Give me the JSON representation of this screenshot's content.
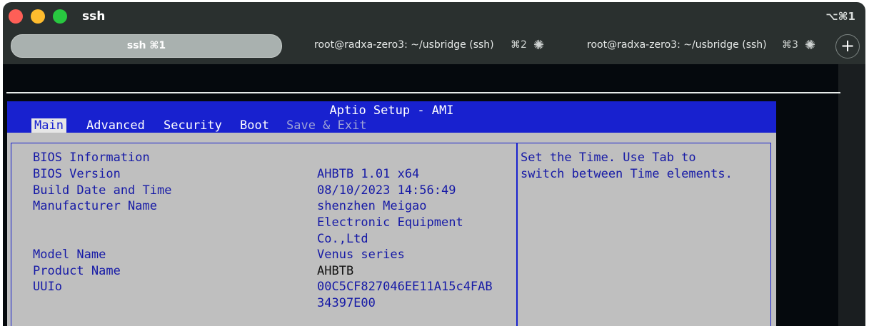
{
  "window": {
    "title": "ssh",
    "shortcut": "⌥⌘1"
  },
  "tabs": [
    {
      "label": "ssh ⌘1"
    },
    {
      "label": "root@radxa-zero3: ~/usbridge (ssh)",
      "key": "⌘2"
    },
    {
      "label": "root@radxa-zero3: ~/usbridge (ssh)",
      "key": "⌘3"
    }
  ],
  "new_tab_label": "+",
  "bios": {
    "title": "Aptio Setup - AMI",
    "menu": [
      "Main",
      "Advanced",
      "Security",
      "Boot",
      "Save & Exit"
    ],
    "rows": [
      {
        "label": "BIOS Information",
        "value": ""
      },
      {
        "label": "BIOS Version",
        "value": "AHBTB 1.01 x64"
      },
      {
        "label": "Build Date and Time",
        "value": "08/10/2023 14:56:49"
      },
      {
        "label": "Manufacturer Name",
        "value": "shenzhen Meigao"
      },
      {
        "label": "",
        "value": "Electronic Equipment"
      },
      {
        "label": "",
        "value": "Co.,Ltd"
      },
      {
        "label": "Model Name",
        "value": "Venus series"
      },
      {
        "label": "Product Name",
        "value": "AHBTB"
      },
      {
        "label": "UUIo",
        "value": "00C5CF827046EE11A15c4FAB"
      },
      {
        "label": "",
        "value": "34397E00"
      }
    ],
    "help": [
      "Set the Time. Use Tab to",
      "switch between Time elements."
    ]
  },
  "colors": {
    "bios_blue": "#1821cf",
    "bios_gray": "#bfbfbf",
    "terminal_bg": "#05090d"
  }
}
